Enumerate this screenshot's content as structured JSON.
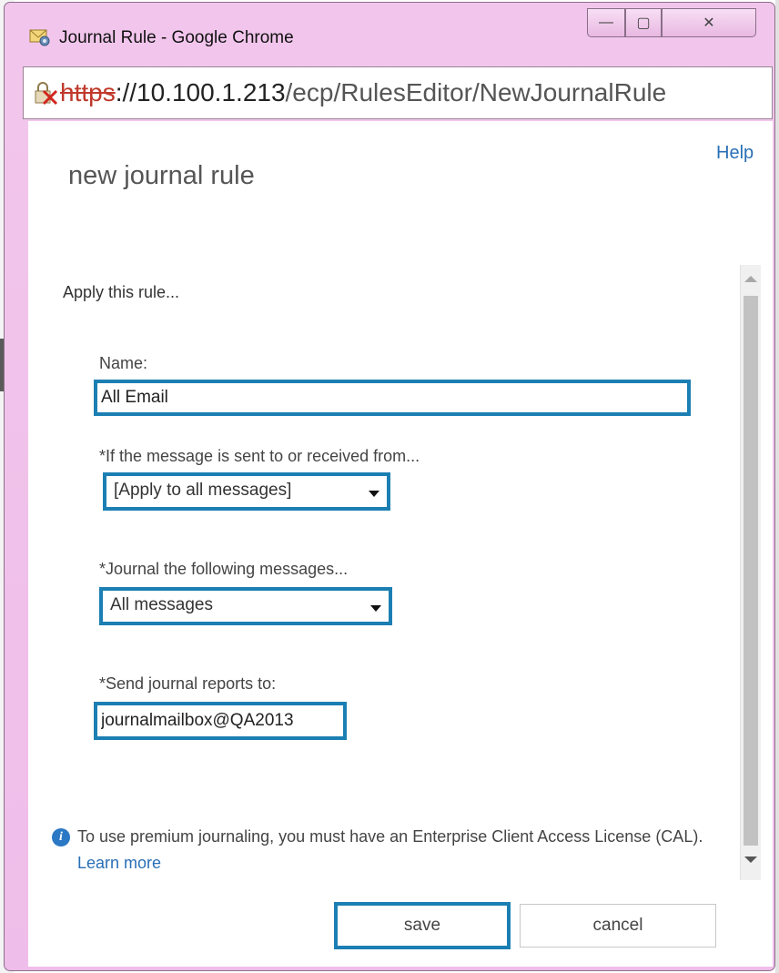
{
  "window": {
    "title": "Journal Rule - Google Chrome",
    "url_scheme": "https",
    "url_host": "://10.100.1.213",
    "url_path": "/ecp/RulesEditor/NewJournalRule"
  },
  "header": {
    "help": "Help",
    "title": "new journal rule"
  },
  "form": {
    "section": "Apply this rule...",
    "name_label": "Name:",
    "name_value": "All Email",
    "sent_label": "*If the message is sent to or received from...",
    "sent_value": "[Apply to all messages]",
    "journal_label": "*Journal the following messages...",
    "journal_value": "All messages",
    "send_label": "*Send journal reports to:",
    "send_value": "journalmailbox@QA2013"
  },
  "info": {
    "text": "To use premium journaling, you must have an Enterprise Client Access License (CAL).",
    "learn_more": "Learn more"
  },
  "buttons": {
    "save": "save",
    "cancel": "cancel"
  },
  "colors": {
    "highlight": "#1b7fb3",
    "link": "#2a6fb5",
    "titlebar": "#f2c6ec"
  }
}
